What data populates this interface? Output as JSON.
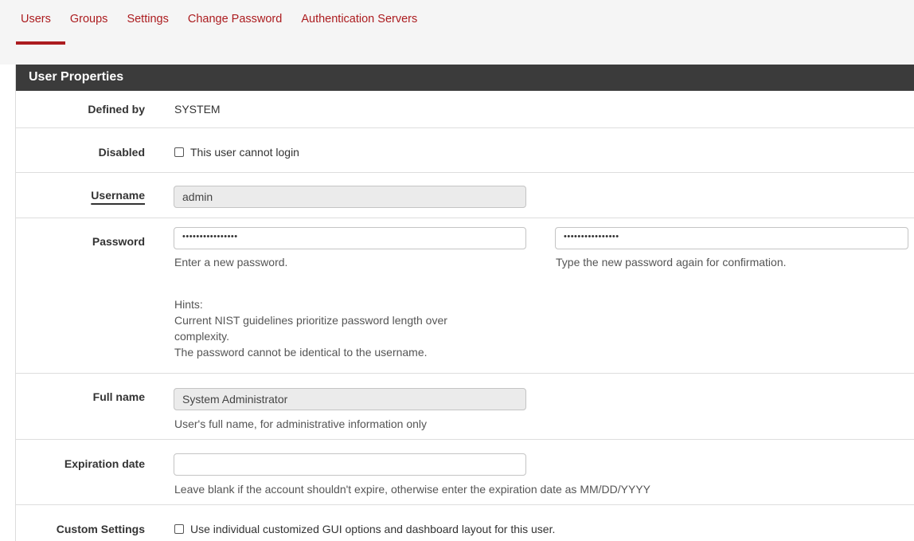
{
  "tabs": [
    {
      "label": "Users",
      "active": true
    },
    {
      "label": "Groups",
      "active": false
    },
    {
      "label": "Settings",
      "active": false
    },
    {
      "label": "Change Password",
      "active": false
    },
    {
      "label": "Authentication Servers",
      "active": false
    }
  ],
  "colors": {
    "accent": "#ac1c1f",
    "heading_bg": "#3b3b3b"
  },
  "panel": {
    "title": "User Properties"
  },
  "fields": {
    "defined_by": {
      "label": "Defined by",
      "value": "SYSTEM"
    },
    "disabled": {
      "label": "Disabled",
      "checkbox_label": "This user cannot login",
      "checked": false
    },
    "username": {
      "label": "Username",
      "value": "admin"
    },
    "password": {
      "label": "Password",
      "value": "••••••••••••••••",
      "confirm_value": "••••••••••••••••",
      "help": "Enter a new password.",
      "confirm_help": "Type the new password again for confirmation.",
      "hints_title": "Hints:",
      "hint_1a": "Current NIST guidelines prioritize password length over",
      "hint_1b": "complexity.",
      "hint_2": "The password cannot be identical to the username."
    },
    "full_name": {
      "label": "Full name",
      "value": "System Administrator",
      "help": "User's full name, for administrative information only"
    },
    "expiration": {
      "label": "Expiration date",
      "value": "",
      "help": "Leave blank if the account shouldn't expire, otherwise enter the expiration date as MM/DD/YYYY"
    },
    "custom_settings": {
      "label": "Custom Settings",
      "checkbox_label": "Use individual customized GUI options and dashboard layout for this user.",
      "checked": false
    }
  }
}
